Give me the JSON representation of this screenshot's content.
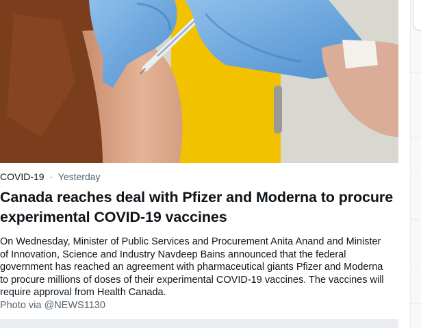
{
  "article": {
    "topic": "COVID-19",
    "separator": "·",
    "time": "Yesterday",
    "headline": "Canada reaches deal with Pfizer and Moderna to procure experimental COVID-19 vaccines",
    "description": "On Wednesday, Minister of Public Services and Procurement Anita Anand and Minister of Innovation, Science and Industry Navdeep Bains announced that the federal government has reached an agreement with pharmaceutical giants Pfizer and Moderna to procure millions of doses of their experimental COVID-19 vaccines. The vaccines will require approval from Health Canada.",
    "photo_credit": "Photo via @NEWS1130"
  },
  "colors": {
    "text_primary": "#0f1419",
    "text_secondary": "#536471",
    "glove_blue": "#6aa6dc",
    "background_yellow": "#f2c200"
  }
}
